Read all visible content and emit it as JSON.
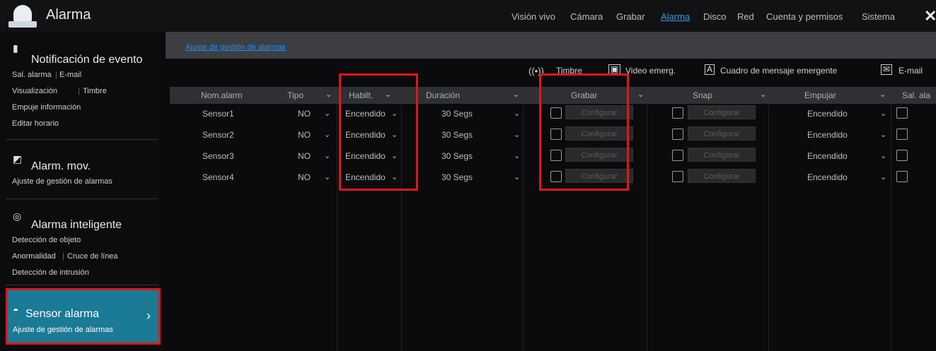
{
  "header": {
    "title": "Alarma",
    "nav": [
      "Visión vivo",
      "Cámara",
      "Grabar",
      "Alarma",
      "Disco",
      "Red",
      "Cuenta y permisos",
      "Sistema"
    ],
    "active_nav": "Alarma",
    "close_icon": "close-icon"
  },
  "sidebar": {
    "event": {
      "title": "Notificación de evento",
      "items_row1": [
        "Sal. alarma",
        "E-mail"
      ],
      "items_row2": [
        "Visualización",
        "Timbre"
      ],
      "item_row3": "Empuje información",
      "item_row4": "Editar horario"
    },
    "motion": {
      "title": "Alarm. mov.",
      "item": "Ajuste de gestión de alarmas"
    },
    "smart": {
      "title": "Alarma inteligente",
      "item_row1": "Detección de objeto",
      "items_row2": [
        "Anormalidad",
        "Cruce de línea"
      ],
      "item_row3": "Detección de intrusión"
    },
    "sensor": {
      "title": "Sensor alarma",
      "item": "Ajuste de gestión de alarmas"
    }
  },
  "main": {
    "subtab": "Ajuste de gestión de alarmas",
    "legend": {
      "buzzer": "Timbre",
      "video_popup": "Video emerg.",
      "popup_message": "Cuadro de mensaje emergente",
      "email": "E-mail"
    },
    "columns": [
      "Nom.alarm",
      "Tipo",
      "Habilt.",
      "Duración",
      "Grabar",
      "Snap",
      "Empujar",
      "Sal. ala"
    ],
    "configure_label": "Configurar",
    "rows": [
      {
        "name": "Sensor1",
        "type": "NO",
        "enabled": "Encendido",
        "duration": "30 Segs",
        "push": "Encendido"
      },
      {
        "name": "Sensor2",
        "type": "NO",
        "enabled": "Encendido",
        "duration": "30 Segs",
        "push": "Encendido"
      },
      {
        "name": "Sensor3",
        "type": "NO",
        "enabled": "Encendido",
        "duration": "30 Segs",
        "push": "Encendido"
      },
      {
        "name": "Sensor4",
        "type": "NO",
        "enabled": "Encendido",
        "duration": "30 Segs",
        "push": "Encendido"
      }
    ]
  },
  "colors": {
    "accent": "#2f9ce0",
    "highlight": "#e0161c",
    "active_sidebar": "#1b7a95"
  }
}
